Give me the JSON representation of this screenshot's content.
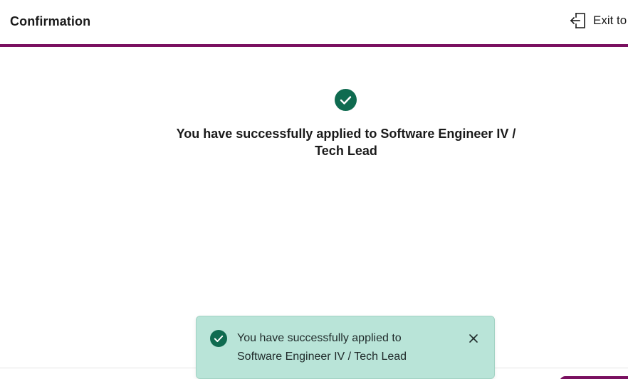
{
  "header": {
    "title": "Confirmation",
    "exit_label": "Exit to",
    "exit_icon": "exit-door-icon"
  },
  "confirmation": {
    "icon": "check-circle-icon",
    "message": "You have successfully applied to Software Engineer IV / Tech Lead"
  },
  "toast": {
    "icon": "check-circle-icon",
    "message": "You have successfully applied to Software Engineer IV / Tech Lead",
    "close_icon": "close-icon"
  },
  "colors": {
    "brand_accent": "#7a1060",
    "success_green": "#0f6b50",
    "toast_background": "#b9e4d8"
  }
}
